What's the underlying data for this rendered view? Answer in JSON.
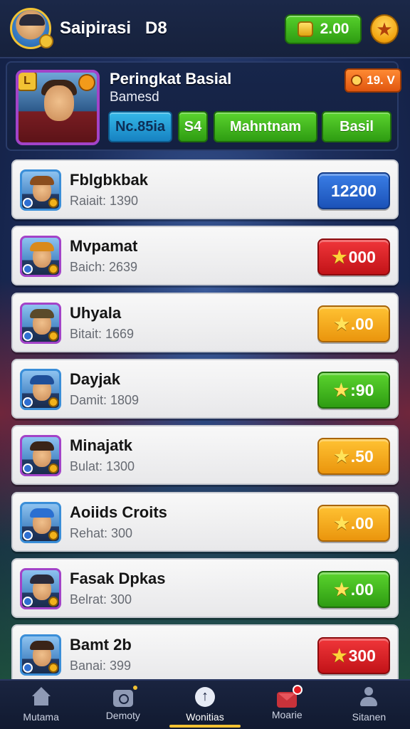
{
  "header": {
    "title": "Saipirasi   D8",
    "coins": "2.00"
  },
  "profile": {
    "name": "Peringkat Basial",
    "subtitle": "Bamesd",
    "rank_badge": "L",
    "level": "19. V",
    "chips": [
      "Nc.85ia",
      "S4",
      "Mahntnam",
      "Basil"
    ]
  },
  "leaderboard": [
    {
      "name": "Fblgbkbak",
      "score": "Raiait: 1390",
      "reward": "12200",
      "star": false,
      "color": "blue",
      "hat_color": "#8a4d1d",
      "frame": "#3a8ed8"
    },
    {
      "name": "Mvpamat",
      "score": "Baich: 2639",
      "reward": "000",
      "star": true,
      "color": "red",
      "hat_color": "#d98a1a",
      "frame": "#a343c8"
    },
    {
      "name": "Uhyala",
      "score": "Bitait: 1669",
      "reward": ".00",
      "star": true,
      "color": "yellow",
      "hat_color": "#5a4a2a",
      "frame": "#a343c8"
    },
    {
      "name": "Dayjak",
      "score": "Damit: 1809",
      "reward": ":90",
      "star": true,
      "color": "green",
      "hat_color": "#1f4f99",
      "frame": "#3a8ed8"
    },
    {
      "name": "Minajatk",
      "score": "Bulat: 1300",
      "reward": ".50",
      "star": true,
      "color": "yellow",
      "hat_color": "#3a2418",
      "frame": "#a343c8"
    },
    {
      "name": "Aoiids Croits",
      "score": "Rehat: 300",
      "reward": ".00",
      "star": true,
      "color": "yellow",
      "hat_color": "#2a6fd1",
      "frame": "#3a8ed8"
    },
    {
      "name": "Fasak Dpkas",
      "score": "Belrat: 300",
      "reward": ".00",
      "star": true,
      "color": "green",
      "hat_color": "#2a2a3a",
      "frame": "#a343c8"
    },
    {
      "name": "Bamt 2b",
      "score": "Banai: 399",
      "reward": "300",
      "star": true,
      "color": "red",
      "hat_color": "#3a2418",
      "frame": "#3a8ed8"
    }
  ],
  "nav": {
    "items": [
      "Mutama",
      "Demoty",
      "Wonitias",
      "Moarie",
      "Sitanen"
    ],
    "active_index": 2
  }
}
